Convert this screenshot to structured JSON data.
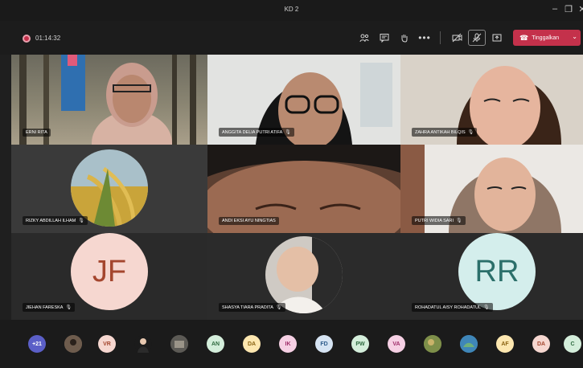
{
  "window": {
    "title": "KD 2"
  },
  "toolbar": {
    "timer": "01:14:32",
    "leave_label": "Tinggalkan",
    "icons": [
      "people-icon",
      "chat-icon",
      "raise-hand-icon",
      "more-icon",
      "camera-off-icon",
      "mic-off-icon",
      "share-icon"
    ]
  },
  "tiles": [
    {
      "name": "ERNI RITA",
      "mic": false
    },
    {
      "name": "ANGGITA DELIA PUTRI ATIFA",
      "mic": true
    },
    {
      "name": "ZAHRA ANTIKAH BILQIS",
      "mic": true
    },
    {
      "name": "RIZKY ABDILLAH ILHAM",
      "mic": true
    },
    {
      "name": "ANDI EKSI AYU NINGTIAS",
      "mic": false
    },
    {
      "name": "PUTRI WIDIA SARI",
      "mic": true
    },
    {
      "name": "JIEHAN FARESKA",
      "mic": true,
      "initials": "JF"
    },
    {
      "name": "SHASYA TIARA PRADITA",
      "mic": true
    },
    {
      "name": "ROHADATUL AISY ROHADATUL",
      "mic": true,
      "initials": "RR"
    }
  ],
  "participants_bar": {
    "overflow": "+21",
    "initials": [
      "VR",
      "AN",
      "DA",
      "IK",
      "FD",
      "PW",
      "VA",
      "AF",
      "DA",
      "C"
    ]
  },
  "colors": {
    "leave": "#c4314b",
    "jf_avatar": "#f6d7d0",
    "rr_avatar": "#d4eeec"
  }
}
